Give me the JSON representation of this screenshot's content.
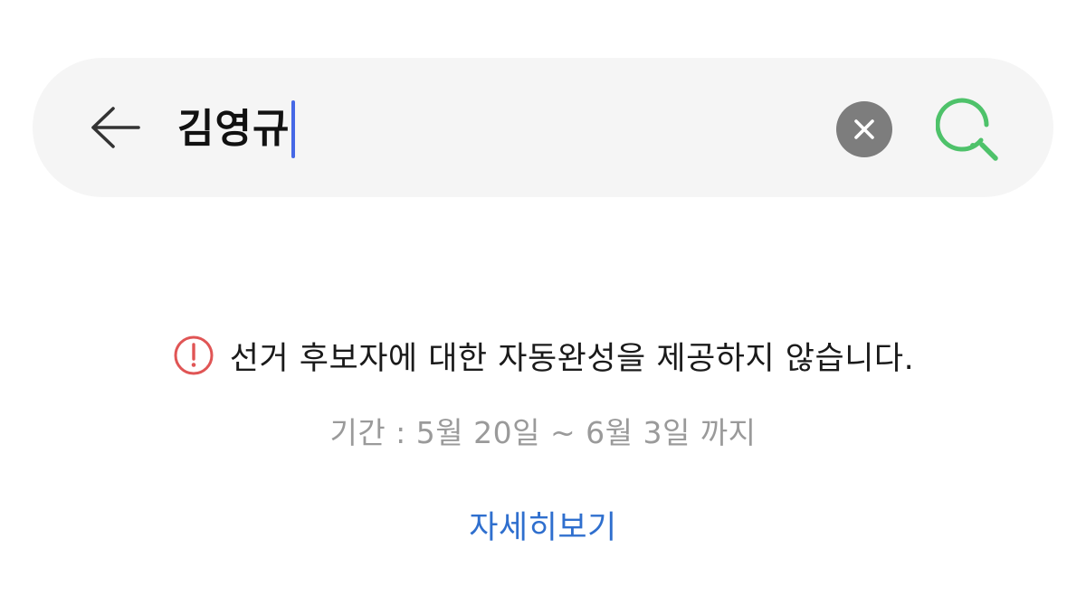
{
  "search": {
    "query": "김영규",
    "icons": {
      "back": "back-arrow-icon",
      "clear": "close-icon",
      "submit": "search-icon"
    },
    "colors": {
      "bar_background": "#f5f5f5",
      "caret": "#4568e6",
      "clear_button": "#7d7d7d",
      "search_icon": "#4ec26a"
    }
  },
  "notice": {
    "icon": "alert-circle-icon",
    "icon_color": "#e05555",
    "message": "선거 후보자에 대한 자동완성을 제공하지 않습니다.",
    "period": "기간 : 5월 20일 ~ 6월 3일 까지",
    "details_label": "자세히보기",
    "link_color": "#2f6fce"
  }
}
